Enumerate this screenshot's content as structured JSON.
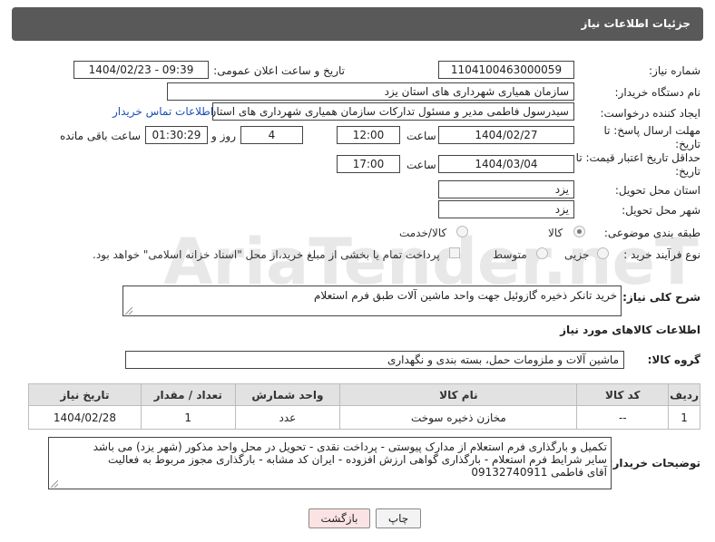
{
  "page": {
    "title": "جزئیات اطلاعات نیاز",
    "watermark": "AriaTender.neT"
  },
  "form": {
    "need_number": {
      "label": "شماره نیاز:",
      "value": "1104100463000059"
    },
    "announce_datetime": {
      "label": "تاریخ و ساعت اعلان عمومی:",
      "value": "1404/02/23 - 09:39"
    },
    "buyer_org": {
      "label": "نام دستگاه خریدار:",
      "value": "سازمان همیاری شهرداری های استان یزد"
    },
    "requester": {
      "label": "ایجاد کننده درخواست:",
      "value": "سیدرسول فاطمی مدیر و مسئول تدارکات سازمان همیاری شهرداری های استان یزد",
      "contact_link": "اطلاعات تماس خریدار"
    },
    "reply_deadline": {
      "label": "مهلت ارسال پاسخ: تا تاریخ:",
      "date": "1404/02/27",
      "time_label": "ساعت",
      "time": "12:00",
      "days": "4",
      "days_label": "روز و",
      "remaining": "01:30:29",
      "remaining_label": "ساعت باقی مانده"
    },
    "price_validity": {
      "label": "حداقل تاریخ اعتبار قیمت: تا تاریخ:",
      "date": "1404/03/04",
      "time_label": "ساعت",
      "time": "17:00"
    },
    "delivery_province": {
      "label": "استان محل تحویل:",
      "value": "یزد"
    },
    "delivery_city": {
      "label": "شهر محل تحویل:",
      "value": "یزد"
    },
    "subject_category": {
      "label": "طبقه بندی موضوعی:",
      "options": [
        "کالا",
        "کالا/خدمت"
      ],
      "selected": "کالا"
    },
    "purchase_type": {
      "label": "نوع فرآیند خرید :",
      "options": [
        "جزیی",
        "متوسط"
      ],
      "selected": "",
      "payment_note": "پرداخت تمام یا بخشی از مبلغ خرید،از محل \"اسناد خزانه اسلامی\" خواهد بود."
    }
  },
  "description": {
    "label": "شرح کلی نیاز:",
    "value": "خرید تانکر ذخیره گازوئیل جهت واحد ماشین آلات طبق فرم استعلام"
  },
  "goods": {
    "section_title": "اطلاعات کالاهای مورد نیاز",
    "group_label": "گروه کالا:",
    "group_value": "ماشین آلات و ملزومات حمل، بسته بندی و نگهداری",
    "table": {
      "headers": [
        "ردیف",
        "کد کالا",
        "نام کالا",
        "واحد شمارش",
        "تعداد / مقدار",
        "تاریخ نیاز"
      ],
      "rows": [
        [
          "1",
          "--",
          "مخازن ذخیره سوخت",
          "عدد",
          "1",
          "1404/02/28"
        ]
      ]
    }
  },
  "buyer_notes": {
    "label": "توضیحات خریدار:",
    "lines": [
      "تکمیل و بارگذاری فرم استعلام از مدارک پیوستی - پرداخت نقدی - تحویل در محل واحد مذکور (شهر یزد) می باشد",
      "سایر شرایط فرم استعلام - بارگذاری گواهی ارزش افزوده - ایران کد مشابه - بارگذاری مجوز مربوط به فعالیت",
      "آقای فاطمی 09132740911"
    ]
  },
  "buttons": {
    "print": "چاپ",
    "back": "بازگشت"
  },
  "colors": {
    "header_bg": "#595959",
    "link": "#1a4fb6",
    "back_button_bg": "#fbe3e3",
    "table_header_bg": "#e2e2e2"
  }
}
